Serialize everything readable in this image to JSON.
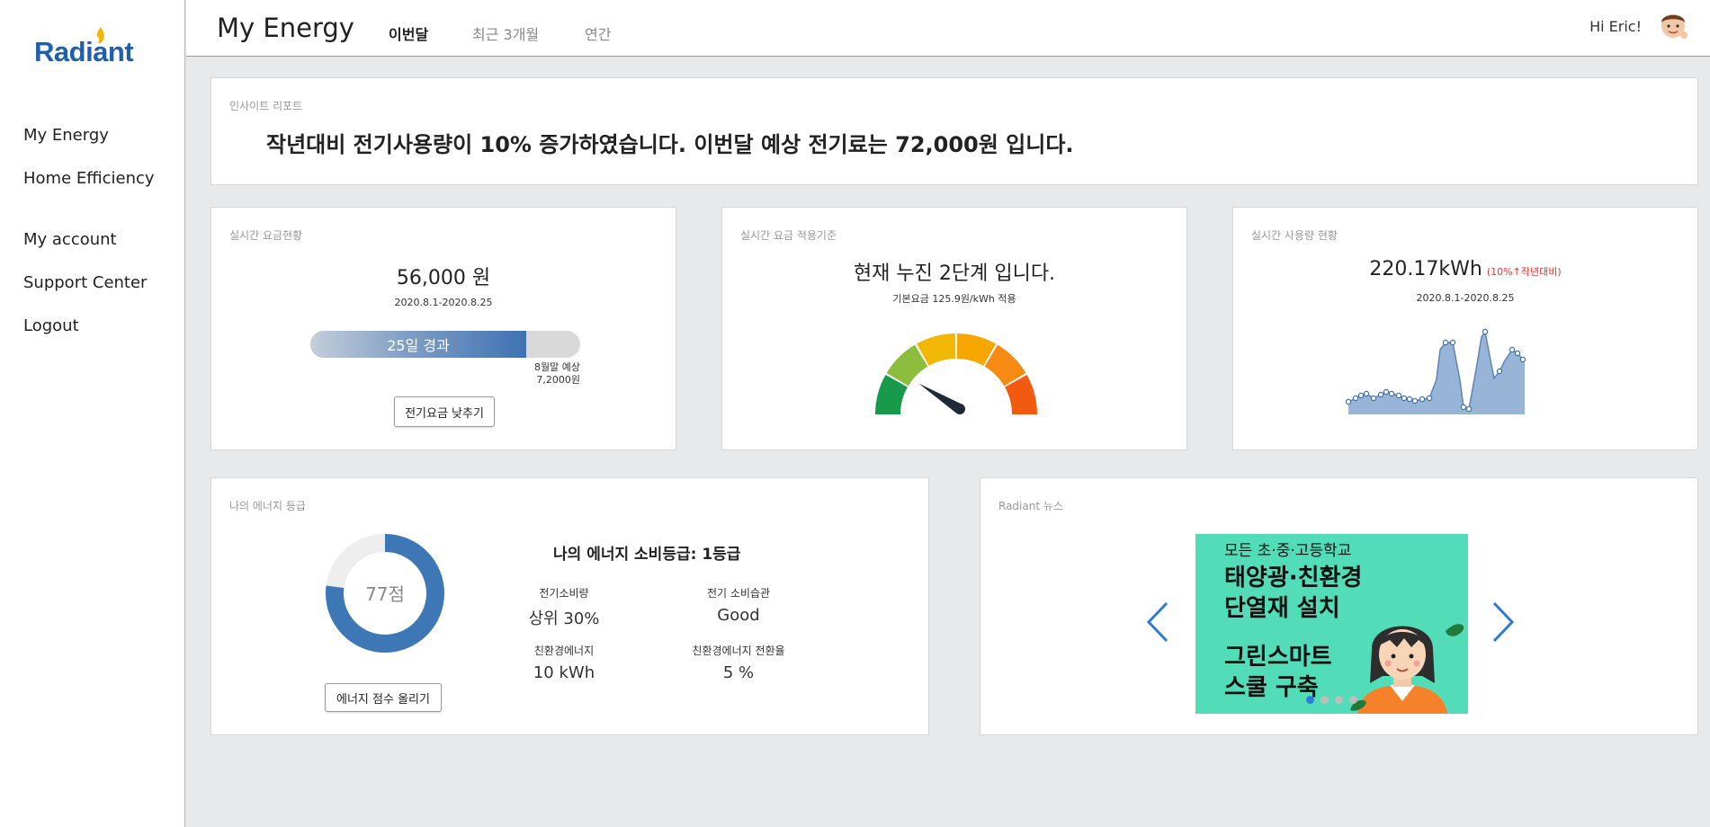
{
  "brand": {
    "name": "Radiant",
    "color": "#1f5fae",
    "flame_color": "#f2b705"
  },
  "sidebar": {
    "items": [
      {
        "label": "My Energy"
      },
      {
        "label": "Home Efficiency"
      },
      {
        "label": "My account"
      },
      {
        "label": "Support Center"
      },
      {
        "label": "Logout"
      }
    ]
  },
  "header": {
    "title": "My Energy",
    "tabs": [
      {
        "label": "이번달",
        "active": true
      },
      {
        "label": "최근 3개월",
        "active": false
      },
      {
        "label": "연간",
        "active": false
      }
    ],
    "greeting": "Hi Eric!",
    "avatar_icon": "user-avatar-icon"
  },
  "insight": {
    "label": "인사이트 리포트",
    "text": "작년대비 전기사용량이 10% 증가하였습니다. 이번달 예상 전기료는 72,000원 입니다."
  },
  "billing": {
    "label": "실시간 요금현황",
    "amount": "56,000 원",
    "period": "2020.8.1-2020.8.25",
    "progress_fraction": 0.8,
    "progress_label": "25일 경과",
    "forecast_label": "8월말 예상",
    "forecast_value": "7,2000원",
    "button_label": "전기요금 낮추기"
  },
  "tier": {
    "label": "실시간 요금 적용기준",
    "headline": "현재 누진 2단계 입니다.",
    "subtext": "기본요금 125.9원/kWh 적용",
    "gauge_segment_colors": [
      "#179b4a",
      "#8cbd3d",
      "#f2b705",
      "#f7a600",
      "#f68a12",
      "#f25b0f"
    ],
    "gauge_level": 0.22
  },
  "usage": {
    "label": "실시간 사용량 현황",
    "value": "220.17kWh",
    "change": "(10%",
    "change_suffix": "작년대비)",
    "change_color": "#e53935",
    "period": "2020.8.1-2020.8.25"
  },
  "grade": {
    "label": "나의 에너지 등급",
    "score_text": "77점",
    "score_fraction": 0.77,
    "title": "나의 에너지 소비등급: 1등급",
    "stats": [
      {
        "label": "전기소비량",
        "value": "상위 30%"
      },
      {
        "label": "전기 소비습관",
        "value": "Good"
      },
      {
        "label": "친환경에너지",
        "value": "10 kWh"
      },
      {
        "label": "친환경에너지 전환율",
        "value": "5 %"
      }
    ],
    "button_label": "에너지 점수 올리기"
  },
  "news": {
    "label": "Radiant 뉴스",
    "banner": {
      "line1": "모든 초·중·고등학교",
      "line2": "태양광·친환경",
      "line3": "단열재 설치",
      "line4": "그린스마트",
      "line5": "스쿨 구축",
      "bg_color": "#52ddb8"
    },
    "dots_count": 4,
    "active_dot": 0
  }
}
